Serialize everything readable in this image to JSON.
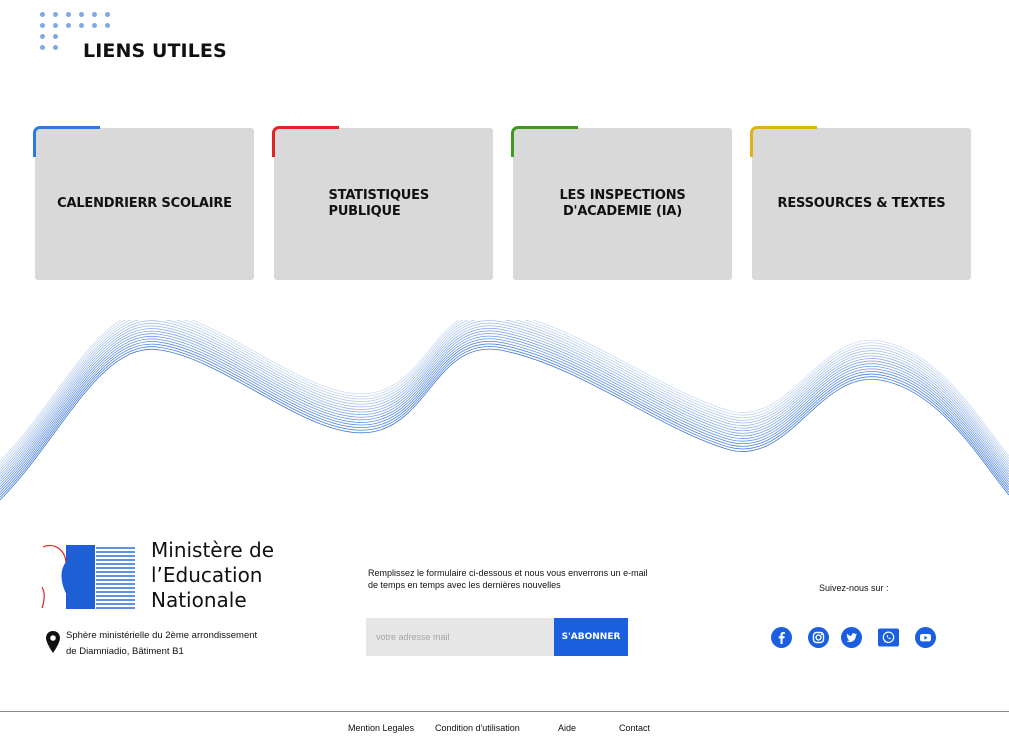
{
  "section": {
    "title": "LIENS UTILES",
    "decor_icon": "dot-grid-icon"
  },
  "cards": [
    {
      "label": "CALENDRIERR SCOLAIRE",
      "accent_color": "#2a7ae2"
    },
    {
      "label": "STATISTIQUES PUBLIQUE",
      "accent_color": "#e02424"
    },
    {
      "label": "LES INSPECTIONS D'ACADEMIE (IA)",
      "accent_color": "#3c9a1d"
    },
    {
      "label": "RESSOURCES & TEXTES",
      "accent_color": "#e0b11b"
    }
  ],
  "footer": {
    "ministry": {
      "line1": "Ministère de",
      "line2": "l’Education",
      "line3": "Nationale",
      "logo_icon": "ministry-logo-icon"
    },
    "address": {
      "icon": "location-pin-icon",
      "line1": "Sphère ministérielle du 2ème arrondissement",
      "line2": "de Diamniadio, Bâtiment B1"
    },
    "newsletter": {
      "text": "Remplissez le formulaire ci-dessous et nous vous enverrons un e-mail de temps en temps avec les dernières nouvelles",
      "email_value": "",
      "email_placeholder": "votre adresse mail",
      "subscribe_label": "S'ABONNER"
    },
    "social": {
      "label": "Suivez-nous sur :",
      "icons": [
        "facebook-icon",
        "instagram-icon",
        "twitter-icon",
        "whatsapp-icon",
        "youtube-icon"
      ]
    },
    "links": [
      "Mention Legales",
      "Condition d'utilisation",
      "Aide",
      "Contact"
    ]
  },
  "colors": {
    "accent_blue": "#1a5fe0",
    "card_bg": "#d9d9d9",
    "social_blue": "#1a5fe0"
  }
}
